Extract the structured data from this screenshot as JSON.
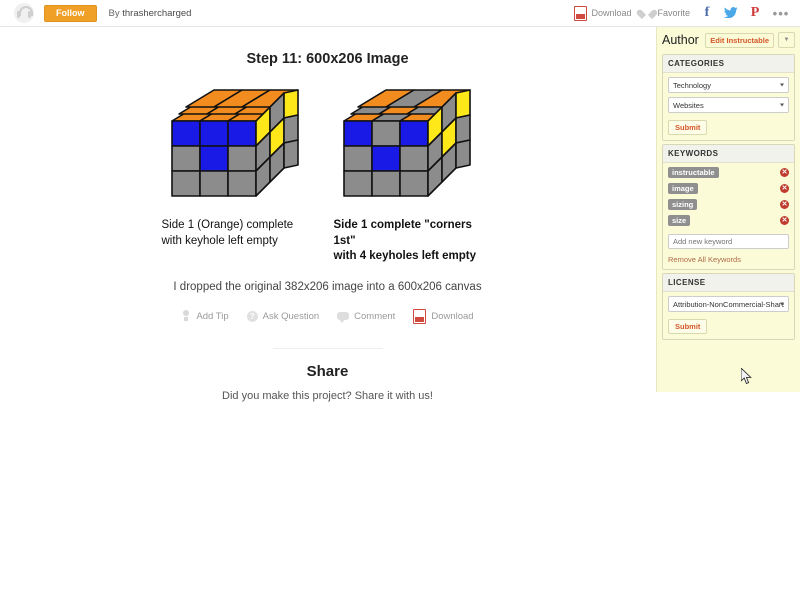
{
  "topbar": {
    "follow_label": "Follow",
    "byline_prefix": "By ",
    "author_name": "thrashercharged",
    "download_label": "Download",
    "favorite_label": "Favorite",
    "facebook_glyph": "f",
    "twitter_glyph": "✈",
    "pinterest_glyph": "P",
    "more_glyph": "•••"
  },
  "main": {
    "step_title": "Step 11: 600x206 Image",
    "cubes": [
      {
        "caption_line1": "Side 1 (Orange) complete",
        "caption_line2": "with keyhole left empty",
        "bold": false
      },
      {
        "caption_line1": "Side 1 complete \"corners 1st\"",
        "caption_line2": "with 4 keyholes left empty",
        "bold": true
      }
    ],
    "body_text": "I dropped the original 382x206 image into a 600x206 canvas",
    "actions": [
      {
        "label": "Add Tip"
      },
      {
        "label": "Ask Question"
      },
      {
        "label": "Comment"
      },
      {
        "label": "Download"
      }
    ],
    "question_glyph": "?",
    "share_title": "Share",
    "share_subtitle": "Did you make this project? Share it with us!"
  },
  "sidebar": {
    "author_label": "Author",
    "edit_button_label": "Edit Instructable",
    "edit_caret_glyph": "▼",
    "categories": {
      "heading": "CATEGORIES",
      "primary_value": "Technology",
      "secondary_value": "Websites",
      "submit_label": "Submit"
    },
    "keywords": {
      "heading": "KEYWORDS",
      "tags": [
        "instructable",
        "image",
        "sizing",
        "size"
      ],
      "delete_glyph": "✕",
      "new_placeholder": "Add new keyword",
      "remove_all_label": "Remove All Keywords"
    },
    "license": {
      "heading": "LICENSE",
      "value": "Attribution-NonCommercial-ShareA",
      "submit_label": "Submit"
    }
  },
  "colors": {
    "follow_orange": "#f0a026",
    "sidebar_yellow": "#fbfbd8",
    "accent_red": "#c0392b",
    "link_orange": "#d4562a",
    "cube_orange": "#f28c1e",
    "cube_blue": "#1a1ae6",
    "cube_yellow": "#ffe81a",
    "cube_gray": "#8c8c8c"
  }
}
